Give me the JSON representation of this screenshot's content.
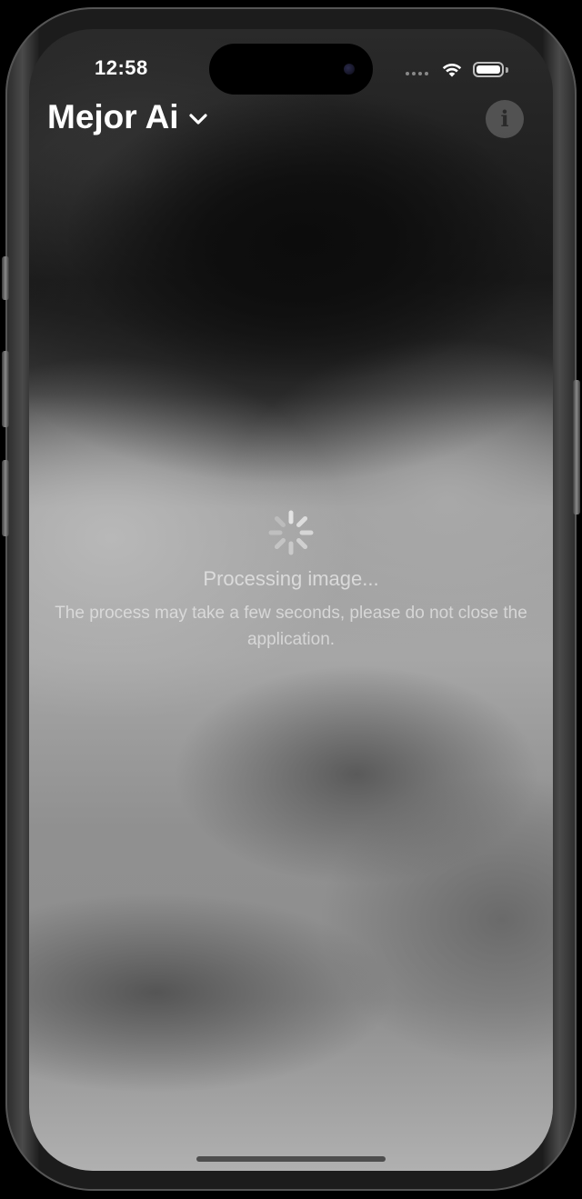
{
  "status_bar": {
    "time": "12:58",
    "wifi_icon": "wifi-icon",
    "battery_icon": "battery-icon"
  },
  "nav": {
    "title": "Mejor Ai",
    "title_icon": "chevron-down-icon",
    "info_icon": "info-icon",
    "info_glyph": "i"
  },
  "loading": {
    "spinner_icon": "activity-spinner-icon",
    "title": "Processing image...",
    "description": "The process may take a few seconds, please do not close the application."
  },
  "colors": {
    "text_primary": "#ffffff",
    "info_button_bg": "#787878"
  }
}
